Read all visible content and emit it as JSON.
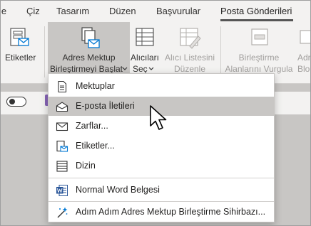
{
  "tabs": [
    {
      "label": "le"
    },
    {
      "label": "Çiz"
    },
    {
      "label": "Tasarım"
    },
    {
      "label": "Düzen"
    },
    {
      "label": "Başvurular"
    },
    {
      "label": "Posta Gönderileri"
    }
  ],
  "ribbon": {
    "labels_button": "Etiketler",
    "start_merge_line1": "Adres Mektup",
    "start_merge_line2": "Birleştirmeyi Başlat",
    "recipients_line1": "Alıcıları",
    "recipients_line2": "Seç",
    "edit_list_line1": "Alıcı Listesini",
    "edit_list_line2": "Düzenle",
    "highlight_line1": "Birleştirme",
    "highlight_line2": "Alanlarını Vurgula",
    "address_line1": "Adr",
    "address_line2": "Blo"
  },
  "menu": {
    "items": [
      {
        "label": "Mektuplar",
        "icon": "letter-icon"
      },
      {
        "label": "E-posta İletileri",
        "icon": "email-icon"
      },
      {
        "label": "Zarflar...",
        "icon": "envelope-icon"
      },
      {
        "label": "Etiketler...",
        "icon": "labels-icon"
      },
      {
        "label": "Dizin",
        "icon": "directory-icon"
      },
      {
        "label": "Normal Word Belgesi",
        "icon": "word-icon"
      },
      {
        "label": "Adım Adım Adres Mektup Birleştirme Sihirbazı...",
        "icon": "wizard-icon"
      }
    ],
    "highlighted_index": 1
  },
  "colors": {
    "ribbon_bg": "#f3f2f1",
    "pressed_bg": "#c8c6c4",
    "menu_highlight": "#c8c6c4",
    "word_blue": "#2b579a",
    "email_blue": "#0078d4",
    "note_purple": "#8764b8"
  }
}
